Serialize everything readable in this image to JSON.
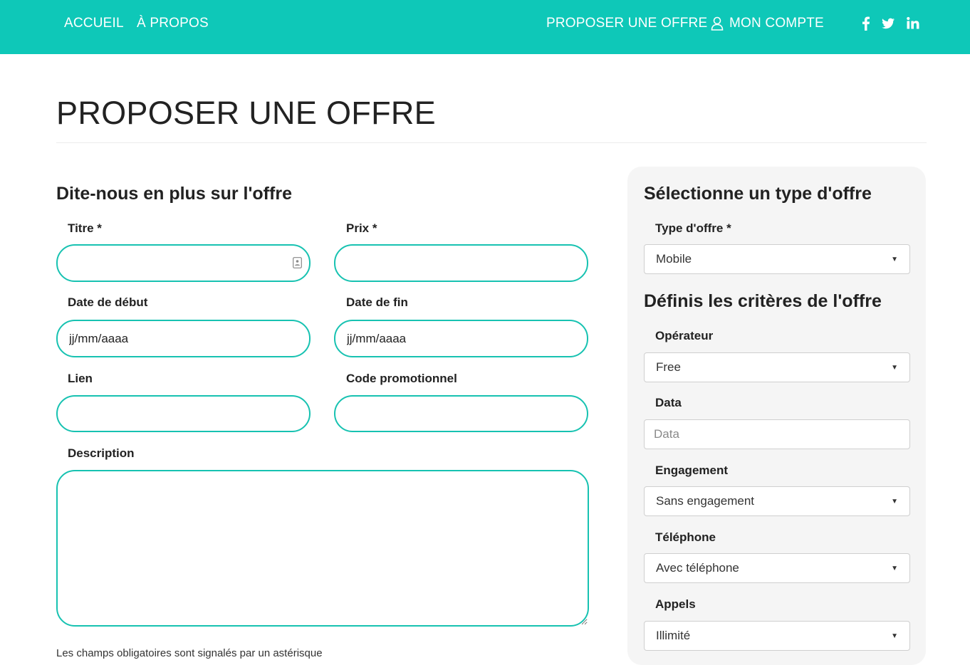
{
  "nav": {
    "home": "ACCUEIL",
    "about": "À PROPOS",
    "propose": "PROPOSER UNE OFFRE",
    "account": "MON COMPTE",
    "social_icons": [
      "facebook-icon",
      "twitter-icon",
      "linkedin-icon"
    ]
  },
  "colors": {
    "brand": "#0ec8b8",
    "input_border": "#17c2b1",
    "sidebar_bg": "#f5f5f5"
  },
  "page_title": "PROPOSER UNE OFFRE",
  "form": {
    "heading": "Dite-nous en plus sur l'offre",
    "title_label": "Titre *",
    "price_label": "Prix *",
    "start_label": "Date de début",
    "start_placeholder": "jj/mm/aaaa",
    "end_label": "Date de fin",
    "end_placeholder": "jj/mm/aaaa",
    "link_label": "Lien",
    "promo_label": "Code promotionnel",
    "description_label": "Description",
    "footer_partial": "Les champs obligatoires sont signalés par un astérisque"
  },
  "sidebar": {
    "type_heading": "Sélectionne un type d'offre",
    "type_label": "Type d'offre *",
    "type_value": "Mobile",
    "criteria_heading": "Définis les critères de l'offre",
    "operator_label": "Opérateur",
    "operator_value": "Free",
    "data_label": "Data",
    "data_placeholder": "Data",
    "engagement_label": "Engagement",
    "engagement_value": "Sans engagement",
    "phone_label": "Téléphone",
    "phone_value": "Avec téléphone",
    "calls_label": "Appels",
    "calls_value": "Illimité"
  }
}
